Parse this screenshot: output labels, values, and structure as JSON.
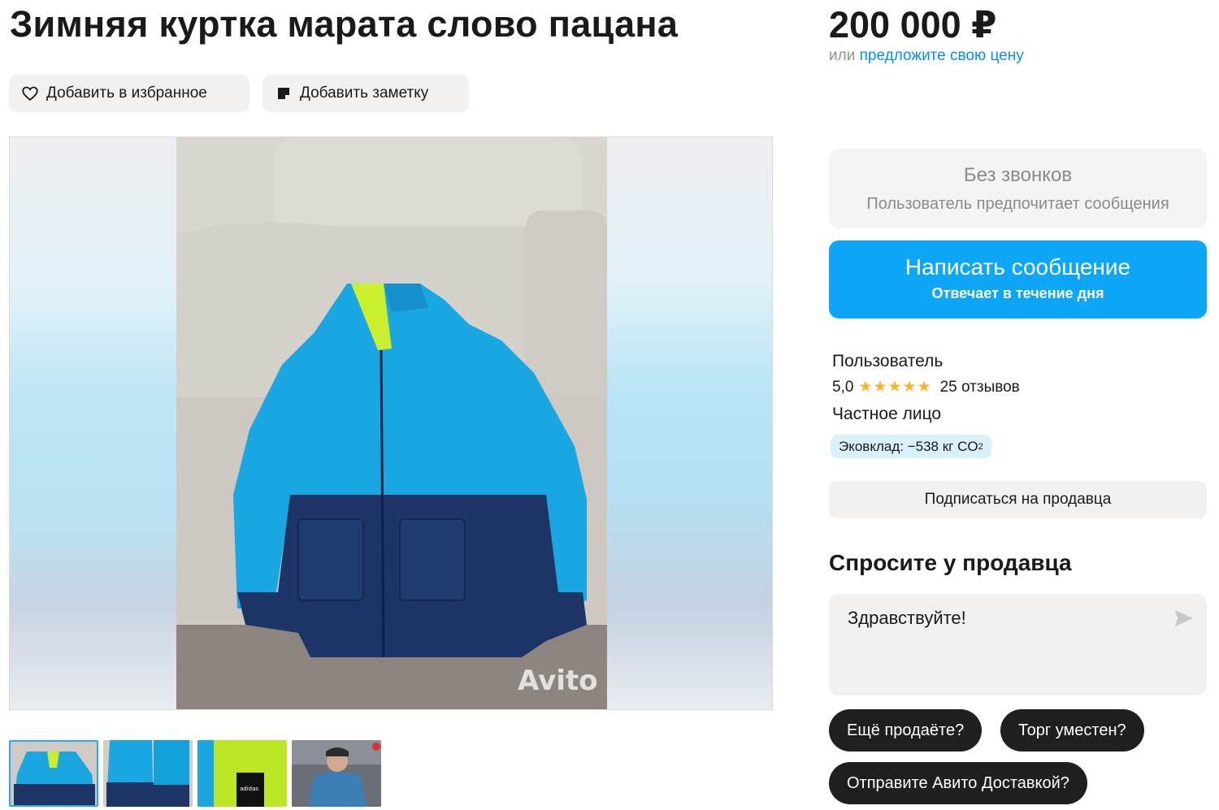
{
  "listing": {
    "title": "Зимняя куртка марата слово пацана",
    "price": "200 000 ₽",
    "offer_prefix": "или",
    "offer_link": "предложите свою цену"
  },
  "actions": {
    "favorite_label": "Добавить в избранное",
    "note_label": "Добавить заметку"
  },
  "gallery": {
    "watermark": "Avito",
    "thumbnail_count": 4,
    "thumb_label": "adidas"
  },
  "contact": {
    "no_calls_title": "Без звонков",
    "no_calls_subtitle": "Пользователь предпочитает сообщения",
    "write_button": "Написать сообщение",
    "write_subtitle": "Отвечает в течение дня"
  },
  "seller": {
    "name": "Пользователь",
    "rating": "5,0",
    "stars": "★★★★★",
    "reviews": "25 отзывов",
    "type": "Частное лицо",
    "eco_label": "Эковклад: −538 кг CO",
    "eco_sub": "2",
    "subscribe_label": "Подписаться на продавца"
  },
  "ask": {
    "title": "Спросите у продавца",
    "message": "Здравствуйте!",
    "chips": [
      "Ещё продаёте?",
      "Торг уместен?",
      "Отправите Авито Доставкой?"
    ]
  },
  "colors": {
    "accent": "#0ea7f7",
    "link": "#0a8cf5",
    "chip_bg": "#1f1f1f",
    "star": "#f8b527"
  },
  "icons": [
    "heart-icon",
    "note-icon",
    "send-icon"
  ]
}
